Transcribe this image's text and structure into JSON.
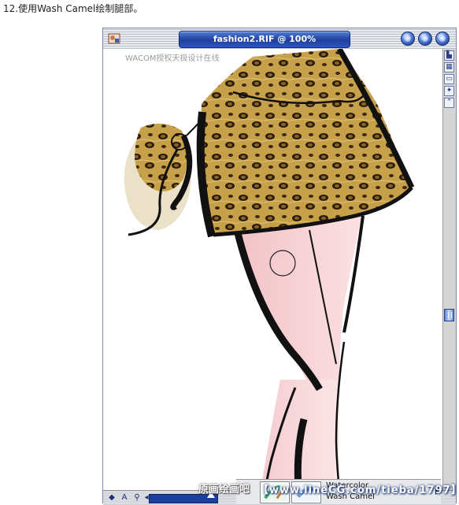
{
  "caption": "12.使用Wash Camel绘制腿部。",
  "window": {
    "title": "fashion2.RIF @ 100%",
    "buttons": [
      "minimize-icon",
      "maximize-icon",
      "close-icon"
    ]
  },
  "canvas": {
    "watermark": "WACOM授权天极设计在线"
  },
  "scroll_icons": [
    "tracing-icon",
    "grid-icon",
    "layer-icon",
    "star-icon",
    "arrow-up-icon"
  ],
  "statusbar": {
    "icons": [
      "navigator-icon",
      "text-icon",
      "zoom-icon",
      "scroll-left-icon"
    ]
  },
  "footer": {
    "site_label": "原画绘画吧",
    "url": "【www.lineCG.com/tieba/1797】"
  },
  "brush_panel": {
    "category": "Watercolor",
    "variant": "Wash Camel"
  },
  "colors": {
    "title_blue": "#1f3f9c",
    "skin": "#f6cfd2",
    "leopard_base": "#c9a24a",
    "outline": "#0a0a0a"
  }
}
